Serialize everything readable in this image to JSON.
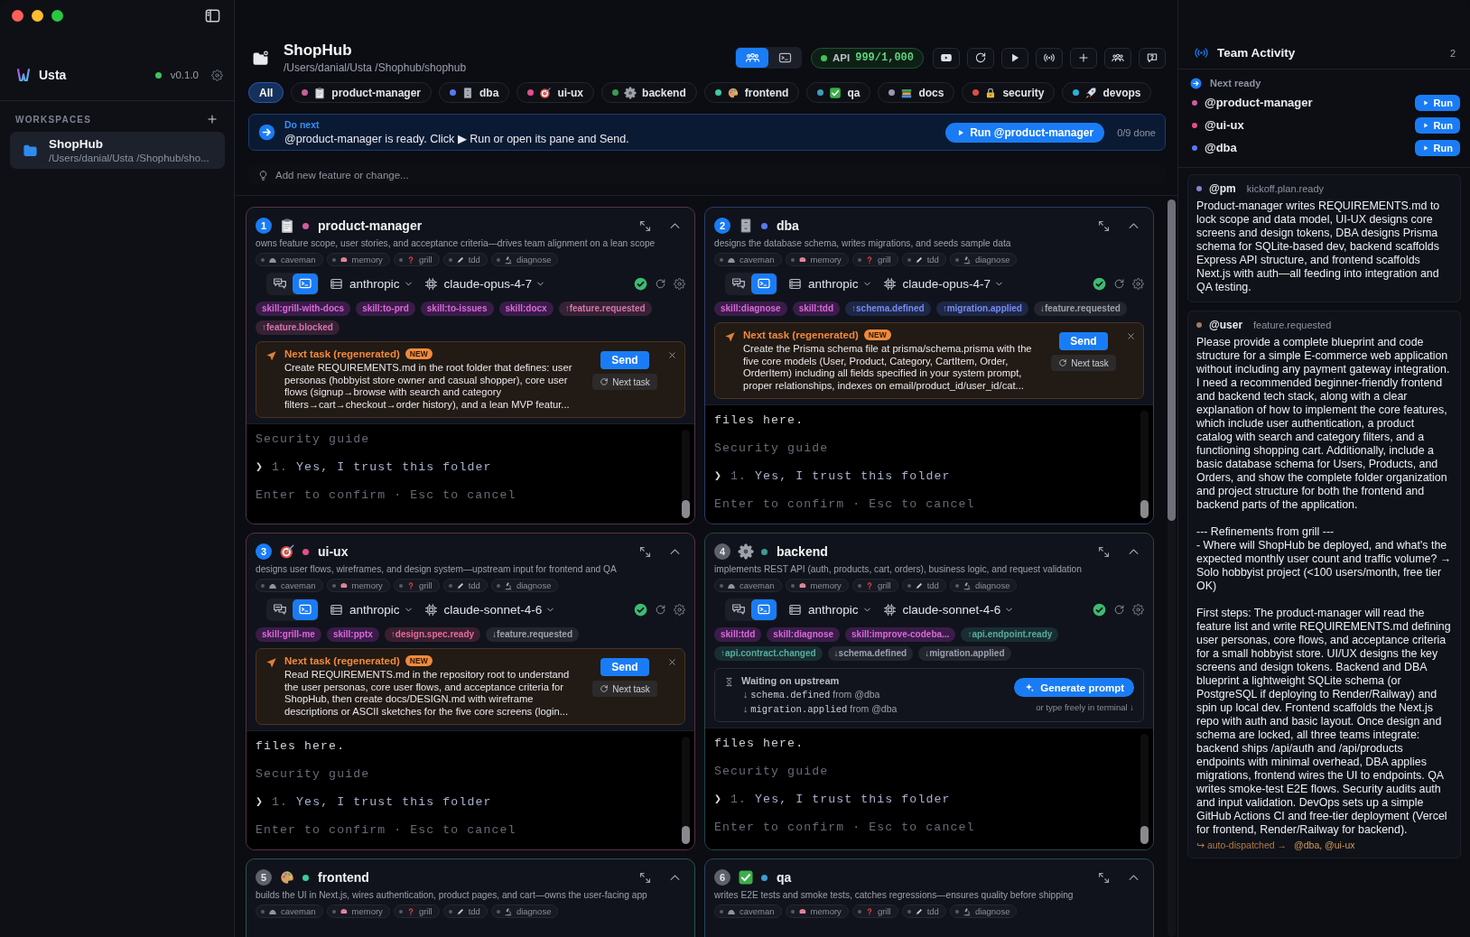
{
  "sidebar": {
    "app": {
      "name": "Usta",
      "version": "v0.1.0",
      "online": true
    },
    "workspaces_heading": "WORKSPACES",
    "workspaces": [
      {
        "name": "ShopHub",
        "path": "/Users/danial/Usta /Shophub/sho...",
        "selected": true
      }
    ]
  },
  "header": {
    "title": "ShopHub",
    "path": "/Users/danial/Usta /Shophub/shophub",
    "view_toggle": [
      {
        "kind": "team",
        "selected": true
      },
      {
        "kind": "terminal",
        "selected": false
      }
    ],
    "api": {
      "label": "API",
      "value": "999/1,000",
      "healthy": true
    }
  },
  "filters": {
    "all": {
      "label": "All",
      "selected": true
    },
    "agents": [
      {
        "label": "product-manager",
        "color": "#c8609a",
        "selected": false
      },
      {
        "label": "dba",
        "color": "#5a78f0",
        "selected": false
      },
      {
        "label": "ui-ux",
        "color": "#e0508a",
        "selected": false
      },
      {
        "label": "backend",
        "color": "#3a9a55",
        "selected": false
      },
      {
        "label": "frontend",
        "color": "#3ccba0",
        "selected": false
      },
      {
        "label": "qa",
        "color": "#3a9ec0",
        "selected": false
      },
      {
        "label": "docs",
        "color": "#9a9aaa",
        "selected": false
      },
      {
        "label": "security",
        "color": "#e04e3e",
        "selected": false
      },
      {
        "label": "devops",
        "color": "#2ab4d4",
        "selected": false
      }
    ]
  },
  "do_next": {
    "heading": "Do next",
    "message": "@product-manager is ready. Click ▶ Run or open its pane and Send.",
    "button": "Run @product-manager",
    "progress": "0/9 done"
  },
  "feature_input": {
    "placeholder": "Add new feature or change..."
  },
  "agents": [
    {
      "number": "1",
      "ready": true,
      "name": "product-manager",
      "color": "#d05c9c",
      "description": "owns feature scope, user stories, and acceptance criteria—drives team alignment on a lean scope",
      "tools": [
        "caveman",
        "memory",
        "grill",
        "tdd",
        "diagnose"
      ],
      "mode_toggle": [
        {
          "kind": "chat",
          "selected": false
        },
        {
          "kind": "terminal",
          "selected": true
        }
      ],
      "provider": "anthropic",
      "model": "claude-opus-4-7",
      "connected": true,
      "tags": [
        {
          "kind": "skill",
          "label": "skill:grill-with-docs"
        },
        {
          "kind": "skill",
          "label": "skill:to-prd"
        },
        {
          "kind": "skill",
          "label": "skill:to-issues"
        },
        {
          "kind": "skill",
          "label": "skill:docx"
        },
        {
          "kind": "emit",
          "label": "↑feature.requested"
        },
        {
          "kind": "emit",
          "label": "↑feature.blocked"
        }
      ],
      "next_task": {
        "title": "Next task (regenerated)",
        "badge": "NEW",
        "text": "Create REQUIREMENTS.md in the root folder that defines: user personas (hobbyist store owner and casual shopper), core user flows (signup→browse with search and category filters→cart→checkout→order history), and a lean MVP featur...",
        "send": "Send",
        "regenerate": "Next task"
      },
      "terminal": [
        {
          "kind": "dim",
          "text": "Security guide"
        },
        {
          "kind": "option",
          "pointer": "❯",
          "number": "1.",
          "text": "Yes, I trust this folder"
        },
        {
          "kind": "dim",
          "text": "Enter to confirm · Esc to cancel"
        }
      ]
    },
    {
      "number": "2",
      "ready": true,
      "name": "dba",
      "color": "#5a78f0",
      "description": "designs the database schema, writes migrations, and seeds sample data",
      "tools": [
        "caveman",
        "memory",
        "grill",
        "tdd",
        "diagnose"
      ],
      "mode_toggle": [
        {
          "kind": "chat",
          "selected": false
        },
        {
          "kind": "terminal",
          "selected": true
        }
      ],
      "provider": "anthropic",
      "model": "claude-opus-4-7",
      "connected": true,
      "tags": [
        {
          "kind": "skill",
          "label": "skill:diagnose"
        },
        {
          "kind": "skill",
          "label": "skill:tdd"
        },
        {
          "kind": "emit",
          "label": "↑schema.defined"
        },
        {
          "kind": "emit",
          "label": "↑migration.applied"
        },
        {
          "kind": "listen",
          "label": "↓feature.requested"
        }
      ],
      "next_task": {
        "title": "Next task (regenerated)",
        "badge": "NEW",
        "text": "Create the Prisma schema file at prisma/schema.prisma with the five core models (User, Product, Category, CartItem, Order, OrderItem) including all fields specified in your system prompt, proper relationships, indexes on email/product_id/user_id/cat...",
        "send": "Send",
        "regenerate": "Next task"
      },
      "terminal": [
        {
          "kind": "plain",
          "text": "files here."
        },
        {
          "kind": "dim",
          "text": "Security guide"
        },
        {
          "kind": "option",
          "pointer": "❯",
          "number": "1.",
          "text": "Yes, I trust this folder"
        },
        {
          "kind": "dim",
          "text": "Enter to confirm · Esc to cancel"
        }
      ]
    },
    {
      "number": "3",
      "ready": true,
      "name": "ui-ux",
      "color": "#e0508a",
      "description": "designs user flows, wireframes, and design system—upstream input for frontend and QA",
      "tools": [
        "caveman",
        "memory",
        "grill",
        "tdd",
        "diagnose"
      ],
      "mode_toggle": [
        {
          "kind": "chat",
          "selected": false
        },
        {
          "kind": "terminal",
          "selected": true
        }
      ],
      "provider": "anthropic",
      "model": "claude-sonnet-4-6",
      "connected": true,
      "tags": [
        {
          "kind": "skill",
          "label": "skill:grill-me"
        },
        {
          "kind": "skill",
          "label": "skill:pptx"
        },
        {
          "kind": "emit",
          "label": "↑design.spec.ready"
        },
        {
          "kind": "listen",
          "label": "↓feature.requested"
        }
      ],
      "next_task": {
        "title": "Next task (regenerated)",
        "badge": "NEW",
        "text": "Read REQUIREMENTS.md in the repository root to understand the user personas, core user flows, and acceptance criteria for ShopHub, then create docs/DESIGN.md with wireframe descriptions or ASCII sketches for the five core screens (login...",
        "send": "Send",
        "regenerate": "Next task"
      },
      "terminal": [
        {
          "kind": "plain",
          "text": "files here."
        },
        {
          "kind": "dim",
          "text": "Security guide"
        },
        {
          "kind": "option",
          "pointer": "❯",
          "number": "1.",
          "text": "Yes, I trust this folder"
        },
        {
          "kind": "dim",
          "text": "Enter to confirm · Esc to cancel"
        }
      ]
    },
    {
      "number": "4",
      "ready": false,
      "name": "backend",
      "color": "#3a9c8e",
      "description": "implements REST API (auth, products, cart, orders), business logic, and request validation",
      "tools": [
        "caveman",
        "memory",
        "grill",
        "tdd",
        "diagnose"
      ],
      "mode_toggle": [
        {
          "kind": "chat",
          "selected": false
        },
        {
          "kind": "terminal",
          "selected": true
        }
      ],
      "provider": "anthropic",
      "model": "claude-sonnet-4-6",
      "connected": true,
      "tags": [
        {
          "kind": "skill",
          "label": "skill:tdd"
        },
        {
          "kind": "skill",
          "label": "skill:diagnose"
        },
        {
          "kind": "skill",
          "label": "skill:improve-codeba..."
        },
        {
          "kind": "emit",
          "label": "↑api.endpoint.ready"
        },
        {
          "kind": "emit",
          "label": "↑api.contract.changed"
        },
        {
          "kind": "listen",
          "label": "↓schema.defined"
        },
        {
          "kind": "listen",
          "label": "↓migration.applied"
        }
      ],
      "waiting": {
        "title": "Waiting on upstream",
        "items": [
          {
            "arrow": "↓",
            "event": "schema.defined",
            "source": "from @dba"
          },
          {
            "arrow": "↓",
            "event": "migration.applied",
            "source": "from @dba"
          }
        ],
        "button": "Generate prompt",
        "hint": "or type freely in terminal ↓"
      },
      "terminal": [
        {
          "kind": "plain",
          "text": "files here."
        },
        {
          "kind": "dim",
          "text": "Security guide"
        },
        {
          "kind": "option",
          "pointer": "❯",
          "number": "1.",
          "text": "Yes, I trust this folder"
        },
        {
          "kind": "dim",
          "text": "Enter to confirm · Esc to cancel"
        }
      ]
    },
    {
      "number": "5",
      "ready": false,
      "name": "frontend",
      "color": "#3ccba0",
      "description": "builds the UI in Next.js, wires authentication, product pages, and cart—owns the user-facing app",
      "tools": [
        "caveman",
        "memory",
        "grill",
        "tdd",
        "diagnose"
      ]
    },
    {
      "number": "6",
      "ready": false,
      "name": "qa",
      "color": "#3a9ed0",
      "description": "writes E2E tests and smoke tests, catches regressions—ensures quality before shipping",
      "tools": [
        "caveman",
        "memory",
        "grill",
        "tdd",
        "diagnose"
      ]
    }
  ],
  "team_activity": {
    "title": "Team Activity",
    "count": "2",
    "next_ready_label": "Next ready",
    "ready": [
      {
        "name": "@product-manager",
        "color": "#c8609a",
        "button": "Run"
      },
      {
        "name": "@ui-ux",
        "color": "#e0508a",
        "button": "Run"
      },
      {
        "name": "@dba",
        "color": "#5a78f0",
        "button": "Run"
      }
    ],
    "events": [
      {
        "author": "@pm",
        "color": "#8a80d0",
        "event": "kickoff.plan.ready",
        "text": "Product-manager writes REQUIREMENTS.md to lock scope and data model, UI-UX designs core screens and design tokens, DBA designs Prisma schema for SQLite-based dev, backend scaffolds Express API structure, and frontend scaffolds Next.js with auth—all feeding into integration and QA testing."
      },
      {
        "author": "@user",
        "color": "#a07a62",
        "event": "feature.requested",
        "text": "Please provide a complete blueprint and code structure for a simple E-commerce web application without including any payment gateway integration. I need a recommended beginner-friendly frontend and backend tech stack, along with a clear explanation of how to implement the core features, which include user authentication, a product catalog with search and category filters, and a functioning shopping cart. Additionally, include a basic database schema for Users, Products, and Orders, and show the complete folder organization and project structure for both the frontend and backend parts of the application.\n\n--- Refinements from grill ---\n- Where will ShopHub be deployed, and what's the expected monthly user count and traffic volume? → Solo hobbyist project (<100 users/month, free tier OK)\n\nFirst steps: The product-manager will read the feature list and write REQUIREMENTS.md defining user personas, core flows, and acceptance criteria for a small hobbyist store. UI/UX designs the key screens and design tokens. Backend and DBA blueprint a lightweight SQLite schema (or PostgreSQL if deploying to Render/Railway) and spin up local dev. Frontend scaffolds the Next.js repo with auth and basic layout. Once design and schema are locked, all three teams integrate: backend ships /api/auth and /api/products endpoints with minimal overhead, DBA applies migrations, frontend wires the UI to endpoints. QA writes smoke-test E2E flows. Security audits auth and input validation. DevOps sets up a simple GitHub Actions CI and free-tier deployment (Vercel for frontend, Render/Railway for backend).",
        "dispatch": {
          "label": "↪ auto-dispatched →",
          "targets": "@dba, @ui-ux"
        }
      }
    ]
  }
}
